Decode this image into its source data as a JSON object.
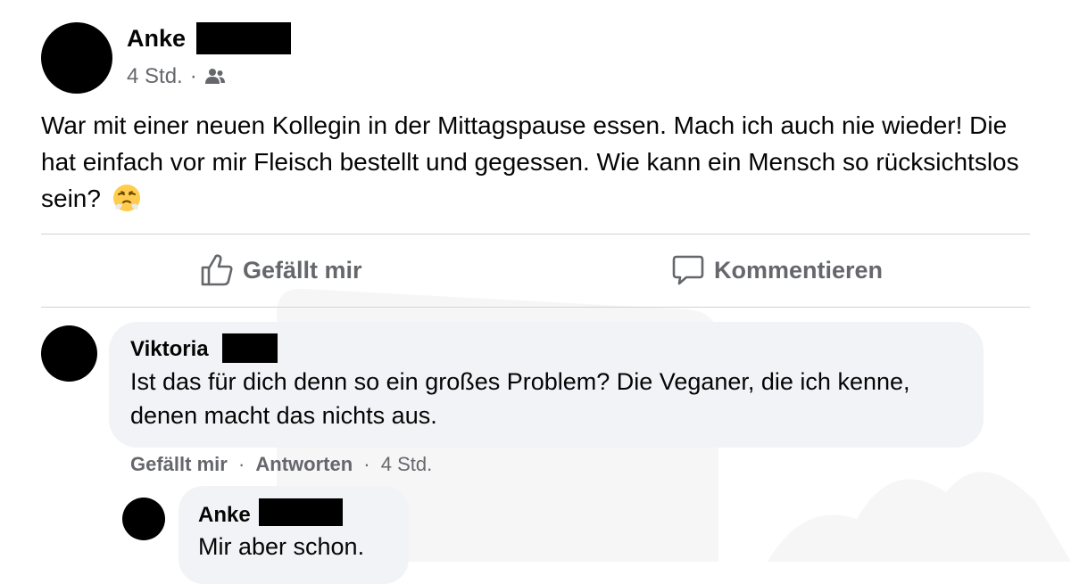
{
  "post": {
    "author": "Anke",
    "time": "4 Std.",
    "dot": "·",
    "audience_icon": "friends-icon",
    "text": "War mit einer neuen Kollegin in der Mittagspause essen. Mach ich auch nie wieder! Die hat einfach vor mir Fleisch bestellt und gegessen. Wie kann ein Mensch so rücksichtslos sein?",
    "emoji": "face-with-steam-from-nose"
  },
  "actions": {
    "like_label": "Gefällt mir",
    "like_icon": "thumbs-up-icon",
    "comment_label": "Kommentieren",
    "comment_icon": "speech-bubble-icon"
  },
  "comments": [
    {
      "author": "Viktoria",
      "text": "Ist das für dich denn so ein großes Problem? Die Veganer, die ich kenne, denen macht das nichts aus.",
      "meta": {
        "like": "Gefällt mir",
        "reply": "Antworten",
        "time": "4 Std.",
        "sep": "·"
      }
    },
    {
      "author": "Anke",
      "text": "Mir aber schon."
    }
  ],
  "colors": {
    "text": "#050505",
    "secondary": "#65676b",
    "bubble": "#f0f2f5",
    "divider": "#cfd2d6",
    "avatar": "#000000",
    "redaction": "#000000"
  }
}
